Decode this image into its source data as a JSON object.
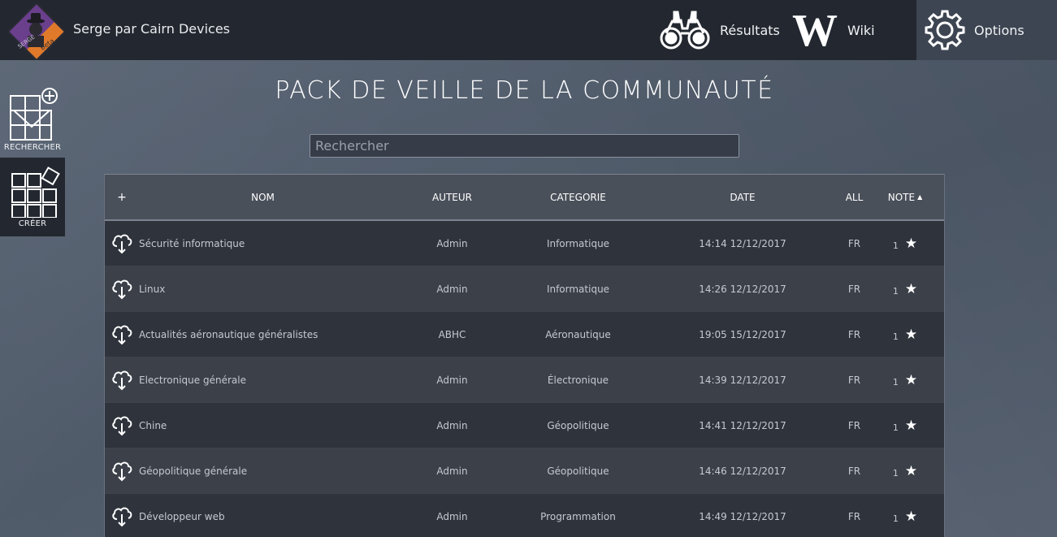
{
  "header": {
    "brand": "Serge par Cairn Devices",
    "logo_text_top": "SERGE",
    "logo_text_bottom": "Beta",
    "nav": [
      {
        "label": "Résultats",
        "icon": "binoculars-icon"
      },
      {
        "label": "Wiki",
        "icon": "wikipedia-w-icon",
        "glyph": "W"
      },
      {
        "label": "Options",
        "icon": "gear-icon"
      }
    ]
  },
  "sidebar": {
    "search_label": "RECHERCHER",
    "create_label": "CRÉER"
  },
  "page": {
    "title": "PACK DE VEILLE DE LA COMMUNAUTÉ",
    "search_placeholder": "Rechercher"
  },
  "table": {
    "headers": {
      "add": "+",
      "name": "NOM",
      "author": "AUTEUR",
      "category": "CATEGORIE",
      "date": "DATE",
      "language": "ALL",
      "rating": "NOTE",
      "sort_indicator": "▲"
    },
    "rows": [
      {
        "name": "Sécurité informatique",
        "author": "Admin",
        "category": "Informatique",
        "date": "14:14 12/12/2017",
        "lang": "FR",
        "rating": "1"
      },
      {
        "name": "Linux",
        "author": "Admin",
        "category": "Informatique",
        "date": "14:26 12/12/2017",
        "lang": "FR",
        "rating": "1"
      },
      {
        "name": "Actualités aéronautique généralistes",
        "author": "ABHC",
        "category": "Aéronautique",
        "date": "19:05 15/12/2017",
        "lang": "FR",
        "rating": "1"
      },
      {
        "name": "Electronique générale",
        "author": "Admin",
        "category": "Électronique",
        "date": "14:39 12/12/2017",
        "lang": "FR",
        "rating": "1"
      },
      {
        "name": "Chine",
        "author": "Admin",
        "category": "Géopolitique",
        "date": "14:41 12/12/2017",
        "lang": "FR",
        "rating": "1"
      },
      {
        "name": "Géopolitique générale",
        "author": "Admin",
        "category": "Géopolitique",
        "date": "14:46 12/12/2017",
        "lang": "FR",
        "rating": "1"
      },
      {
        "name": "Développeur web",
        "author": "Admin",
        "category": "Programmation",
        "date": "14:49 12/12/2017",
        "lang": "FR",
        "rating": "1"
      }
    ],
    "star_glyph": "★"
  },
  "colors": {
    "topbar": "#232830",
    "options_bg": "#3d4552",
    "row_odd": "#2e333c",
    "row_even": "#3b4049",
    "logo_purple": "#6a3f8c",
    "logo_orange": "#e07a2a"
  }
}
